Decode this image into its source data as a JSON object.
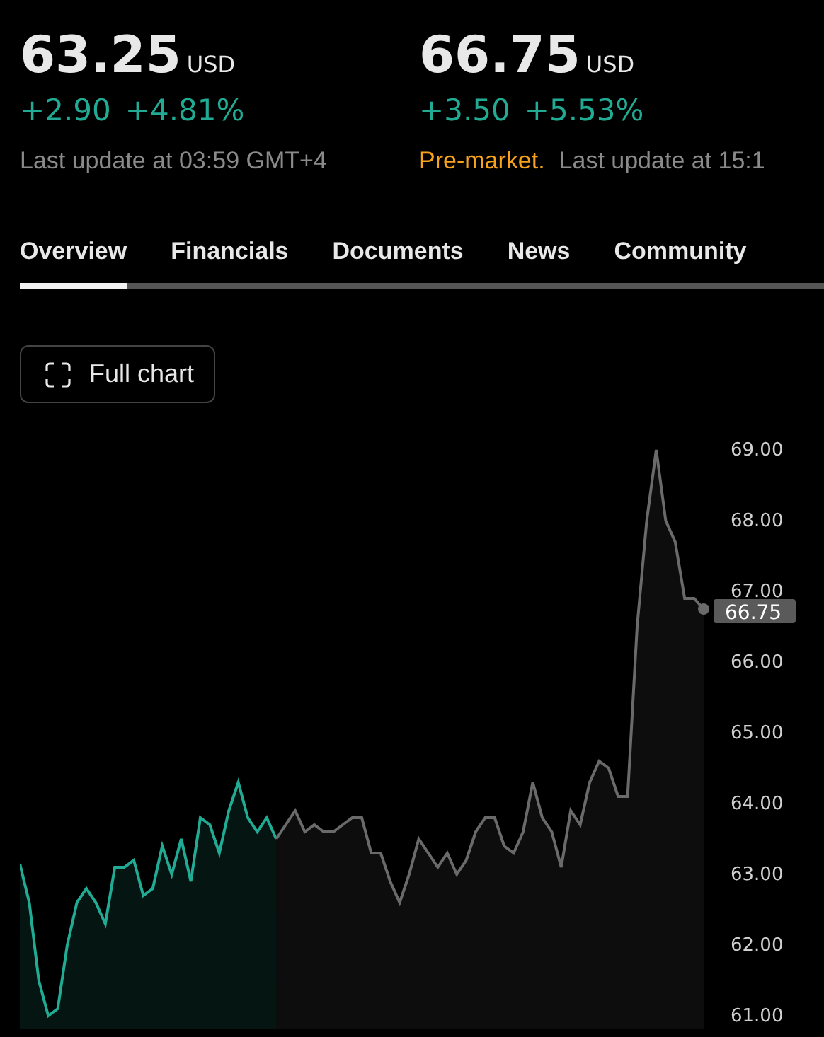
{
  "quotes": [
    {
      "price": "63.25",
      "currency": "USD",
      "change": "+2.90",
      "change_percent": "+4.81%",
      "update": "Last update at 03:59 GMT+4"
    },
    {
      "price": "66.75",
      "currency": "USD",
      "change": "+3.50",
      "change_percent": "+5.53%",
      "session_label": "Pre-market.",
      "update": "Last update at 15:1"
    }
  ],
  "tabs": [
    {
      "label": "Overview",
      "selected": true
    },
    {
      "label": "Financials",
      "selected": false
    },
    {
      "label": "Documents",
      "selected": false
    },
    {
      "label": "News",
      "selected": false
    },
    {
      "label": "Community",
      "selected": false
    }
  ],
  "full_chart_button": {
    "label": "Full chart"
  },
  "chart": {
    "last_price_label": "66.75",
    "chart_data": {
      "type": "area",
      "ylim": [
        61,
        69
      ],
      "yticks": [
        {
          "value": 69,
          "label": "69.00"
        },
        {
          "value": 68,
          "label": "68.00"
        },
        {
          "value": 67,
          "label": "67.00"
        },
        {
          "value": 66,
          "label": "66.00"
        },
        {
          "value": 65,
          "label": "65.00"
        },
        {
          "value": 64,
          "label": "64.00"
        },
        {
          "value": 63,
          "label": "63.00"
        },
        {
          "value": 62,
          "label": "62.00"
        },
        {
          "value": 61,
          "label": "61.00"
        }
      ],
      "series": [
        {
          "color": "#22ab94",
          "values": [
            63.15,
            62.6,
            61.5,
            61.0,
            61.1,
            62.0,
            62.6,
            62.8,
            62.6,
            62.3,
            63.1,
            63.1,
            63.2,
            62.7,
            62.8,
            63.4,
            63.0,
            63.5,
            62.9,
            63.8,
            63.7,
            63.3,
            63.9,
            64.3,
            63.8,
            63.6,
            63.8,
            63.5,
            null,
            null,
            null,
            null,
            null,
            null,
            null,
            null,
            null,
            null,
            null,
            null,
            null,
            null,
            null,
            null,
            null,
            null,
            null,
            null,
            null,
            null,
            null,
            null,
            null,
            null,
            null,
            null,
            null,
            null,
            null,
            null,
            null,
            null,
            null,
            null,
            null,
            null,
            null,
            null,
            null,
            null,
            null,
            null,
            null
          ]
        },
        {
          "color": "#6a6a6a",
          "values": [
            null,
            null,
            null,
            null,
            null,
            null,
            null,
            null,
            null,
            null,
            null,
            null,
            null,
            null,
            null,
            null,
            null,
            null,
            null,
            null,
            null,
            null,
            null,
            null,
            null,
            null,
            null,
            63.5,
            63.7,
            63.9,
            63.6,
            63.7,
            63.6,
            63.6,
            63.7,
            63.8,
            63.8,
            63.3,
            63.3,
            62.9,
            62.6,
            63.0,
            63.5,
            63.3,
            63.1,
            63.3,
            63.0,
            63.2,
            63.6,
            63.8,
            63.8,
            63.4,
            63.3,
            63.6,
            64.3,
            63.8,
            63.6,
            63.1,
            63.9,
            63.7,
            64.3,
            64.6,
            64.5,
            64.1,
            64.1,
            66.5,
            68.0,
            69.0,
            68.0,
            67.7,
            66.9,
            66.9,
            66.75
          ]
        }
      ]
    }
  }
}
